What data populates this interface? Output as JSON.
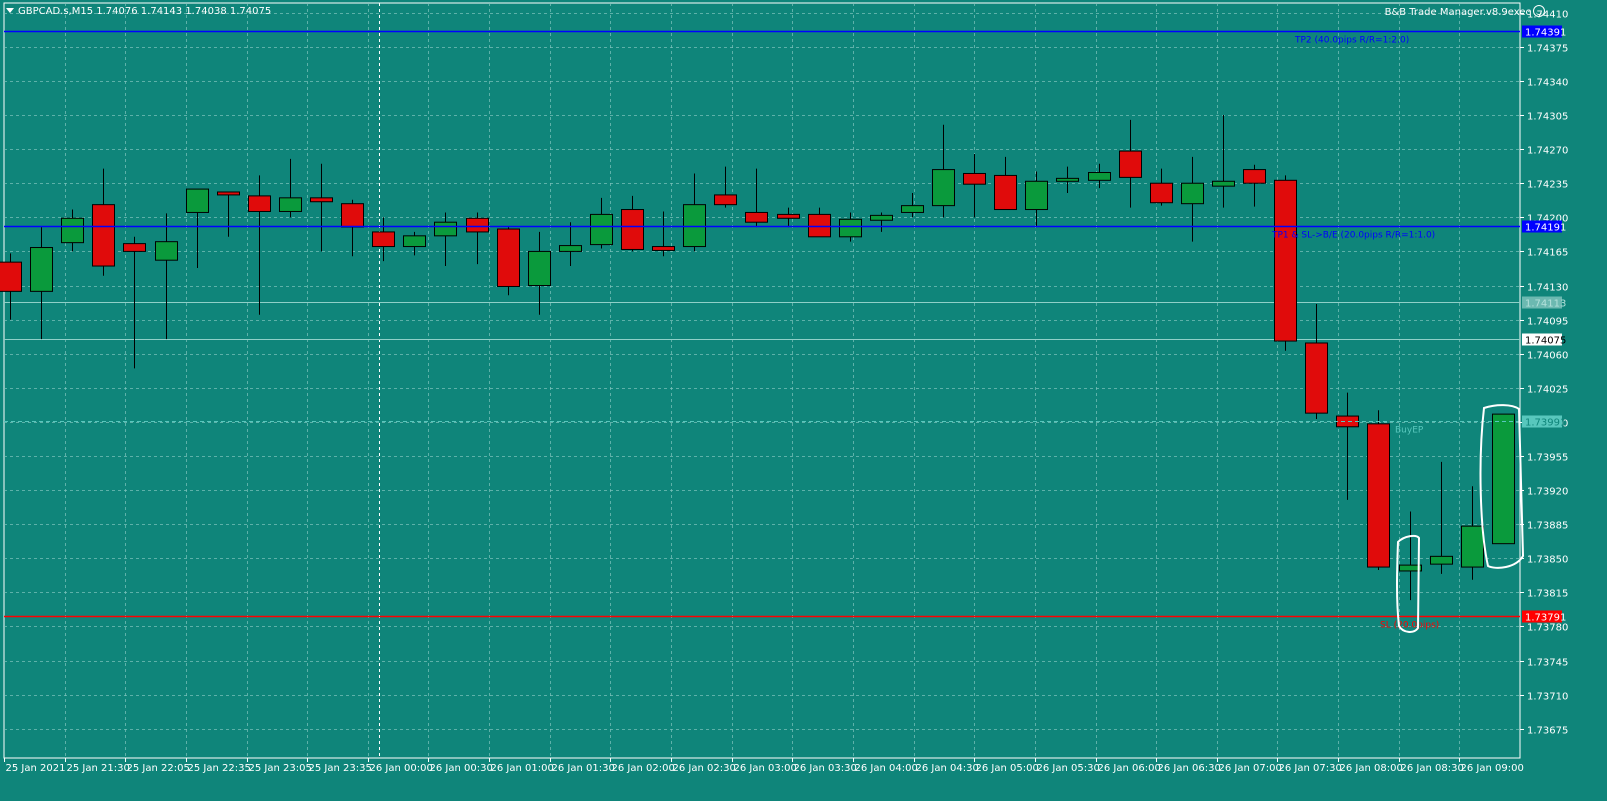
{
  "header": {
    "symbol_info": "GBPCAD.s,M15  1.74076 1.74143 1.74038 1.74075",
    "ea_label": "B&B Trade Manager.v8.9exec"
  },
  "colors": {
    "background": "#0f857a",
    "grid": "#7fc4bd",
    "axis_text": "#ffffff",
    "bull_fill": "#0a9a3c",
    "bear_fill": "#e00b0b",
    "wick": "#000000",
    "tp_line": "#0000ff",
    "sl_line": "#ff0000",
    "entry_line": "#58c7bd"
  },
  "chart_data": {
    "type": "candlestick",
    "symbol": "GBPCAD.s",
    "timeframe": "M15",
    "ylim": [
      1.73645,
      1.7442
    ],
    "y_ticks": [
      "1.74410",
      "1.74375",
      "1.74340",
      "1.74305",
      "1.74270",
      "1.74235",
      "1.74200",
      "1.74165",
      "1.74130",
      "1.74095",
      "1.74060",
      "1.74025",
      "1.73990",
      "1.73955",
      "1.73920",
      "1.73885",
      "1.73850",
      "1.73815",
      "1.73780",
      "1.73745",
      "1.73710",
      "1.73675"
    ],
    "x_labels": [
      "25 Jan 2021",
      "25 Jan 21:30",
      "25 Jan 22:05",
      "25 Jan 22:35",
      "25 Jan 23:05",
      "25 Jan 23:35",
      "26 Jan 00:00",
      "26 Jan 00:30",
      "26 Jan 01:00",
      "26 Jan 01:30",
      "26 Jan 02:00",
      "26 Jan 02:30",
      "26 Jan 03:00",
      "26 Jan 03:30",
      "26 Jan 04:00",
      "26 Jan 04:30",
      "26 Jan 05:00",
      "26 Jan 05:30",
      "26 Jan 06:00",
      "26 Jan 06:30",
      "26 Jan 07:00",
      "26 Jan 07:30",
      "26 Jan 08:00",
      "26 Jan 08:30",
      "26 Jan 09:00"
    ],
    "candles": [
      {
        "o": 1.74154,
        "h": 1.74163,
        "l": 1.74095,
        "c": 1.74124
      },
      {
        "o": 1.74124,
        "h": 1.7419,
        "l": 1.74075,
        "c": 1.74169
      },
      {
        "o": 1.74174,
        "h": 1.74208,
        "l": 1.74165,
        "c": 1.74199
      },
      {
        "o": 1.74213,
        "h": 1.7425,
        "l": 1.7414,
        "c": 1.7415
      },
      {
        "o": 1.74173,
        "h": 1.7418,
        "l": 1.74045,
        "c": 1.74165
      },
      {
        "o": 1.74156,
        "h": 1.74204,
        "l": 1.74075,
        "c": 1.74175
      },
      {
        "o": 1.74205,
        "h": 1.74229,
        "l": 1.74148,
        "c": 1.74229
      },
      {
        "o": 1.74226,
        "h": 1.74226,
        "l": 1.7418,
        "c": 1.74223
      },
      {
        "o": 1.74222,
        "h": 1.74243,
        "l": 1.741,
        "c": 1.74206
      },
      {
        "o": 1.74206,
        "h": 1.7426,
        "l": 1.742,
        "c": 1.7422
      },
      {
        "o": 1.7422,
        "h": 1.74255,
        "l": 1.74165,
        "c": 1.74216
      },
      {
        "o": 1.74214,
        "h": 1.74218,
        "l": 1.7416,
        "c": 1.7419
      },
      {
        "o": 1.74185,
        "h": 1.742,
        "l": 1.74155,
        "c": 1.7417
      },
      {
        "o": 1.7417,
        "h": 1.74185,
        "l": 1.74161,
        "c": 1.74181
      },
      {
        "o": 1.74181,
        "h": 1.74205,
        "l": 1.7415,
        "c": 1.74195
      },
      {
        "o": 1.74199,
        "h": 1.74205,
        "l": 1.74152,
        "c": 1.74185
      },
      {
        "o": 1.74188,
        "h": 1.7419,
        "l": 1.7412,
        "c": 1.74129
      },
      {
        "o": 1.7413,
        "h": 1.74185,
        "l": 1.741,
        "c": 1.74165
      },
      {
        "o": 1.74165,
        "h": 1.74195,
        "l": 1.7415,
        "c": 1.74171
      },
      {
        "o": 1.74172,
        "h": 1.7422,
        "l": 1.74168,
        "c": 1.74203
      },
      {
        "o": 1.74208,
        "h": 1.74222,
        "l": 1.74165,
        "c": 1.74167
      },
      {
        "o": 1.7417,
        "h": 1.74206,
        "l": 1.7416,
        "c": 1.74166
      },
      {
        "o": 1.7417,
        "h": 1.74245,
        "l": 1.74165,
        "c": 1.74213
      },
      {
        "o": 1.74223,
        "h": 1.74252,
        "l": 1.7421,
        "c": 1.74213
      },
      {
        "o": 1.74205,
        "h": 1.7425,
        "l": 1.7419,
        "c": 1.74195
      },
      {
        "o": 1.74203,
        "h": 1.7421,
        "l": 1.7419,
        "c": 1.74199
      },
      {
        "o": 1.74203,
        "h": 1.7421,
        "l": 1.7418,
        "c": 1.7418
      },
      {
        "o": 1.7418,
        "h": 1.74205,
        "l": 1.74175,
        "c": 1.74198
      },
      {
        "o": 1.74197,
        "h": 1.74205,
        "l": 1.74185,
        "c": 1.74202
      },
      {
        "o": 1.74205,
        "h": 1.74225,
        "l": 1.742,
        "c": 1.74212
      },
      {
        "o": 1.74212,
        "h": 1.74295,
        "l": 1.742,
        "c": 1.74249
      },
      {
        "o": 1.74245,
        "h": 1.74265,
        "l": 1.742,
        "c": 1.74234
      },
      {
        "o": 1.74243,
        "h": 1.74262,
        "l": 1.7421,
        "c": 1.74208
      },
      {
        "o": 1.74208,
        "h": 1.74247,
        "l": 1.7419,
        "c": 1.74237
      },
      {
        "o": 1.74237,
        "h": 1.74252,
        "l": 1.74225,
        "c": 1.7424
      },
      {
        "o": 1.74238,
        "h": 1.74255,
        "l": 1.7423,
        "c": 1.74246
      },
      {
        "o": 1.74268,
        "h": 1.743,
        "l": 1.7421,
        "c": 1.74241
      },
      {
        "o": 1.74235,
        "h": 1.7425,
        "l": 1.74212,
        "c": 1.74215
      },
      {
        "o": 1.74214,
        "h": 1.74262,
        "l": 1.74175,
        "c": 1.74235
      },
      {
        "o": 1.74232,
        "h": 1.74305,
        "l": 1.7421,
        "c": 1.74237
      },
      {
        "o": 1.74249,
        "h": 1.74254,
        "l": 1.74211,
        "c": 1.74235
      },
      {
        "o": 1.74238,
        "h": 1.74243,
        "l": 1.74063,
        "c": 1.74073
      },
      {
        "o": 1.74071,
        "h": 1.74111,
        "l": 1.73993,
        "c": 1.73999
      },
      {
        "o": 1.73996,
        "h": 1.7402,
        "l": 1.7391,
        "c": 1.73985
      },
      {
        "o": 1.73988,
        "h": 1.74002,
        "l": 1.73838,
        "c": 1.73841
      },
      {
        "o": 1.73837,
        "h": 1.73898,
        "l": 1.73807,
        "c": 1.73843
      },
      {
        "o": 1.73844,
        "h": 1.73949,
        "l": 1.73834,
        "c": 1.73852
      },
      {
        "o": 1.73841,
        "h": 1.73924,
        "l": 1.73828,
        "c": 1.73883
      },
      {
        "o": 1.73865,
        "h": 1.73997,
        "l": 1.73865,
        "c": 1.73998
      }
    ],
    "lines": [
      {
        "name": "TP2",
        "price": 1.74391,
        "price_label": "1.74391",
        "color": "#0000ff",
        "text": "TP2 (40.0pips R/R=1:2.0)"
      },
      {
        "name": "TP1",
        "price": 1.74191,
        "price_label": "1.74191",
        "color": "#0000ff",
        "text": "TP1 & SL->B/E (20.0pips R/R=1:1.0)"
      },
      {
        "name": "SL",
        "price": 1.73791,
        "price_label": "1.73791",
        "color": "#ff0000",
        "text": "SL (20.0pips)"
      },
      {
        "name": "Entry",
        "price": 1.73991,
        "price_label": "1.73991",
        "color": "#58c7bd",
        "text": "BuyEP"
      }
    ],
    "current_price": "1.74075",
    "current_price_value": 1.74075,
    "ask_label": "1.74113",
    "ask_value": 1.74113
  }
}
